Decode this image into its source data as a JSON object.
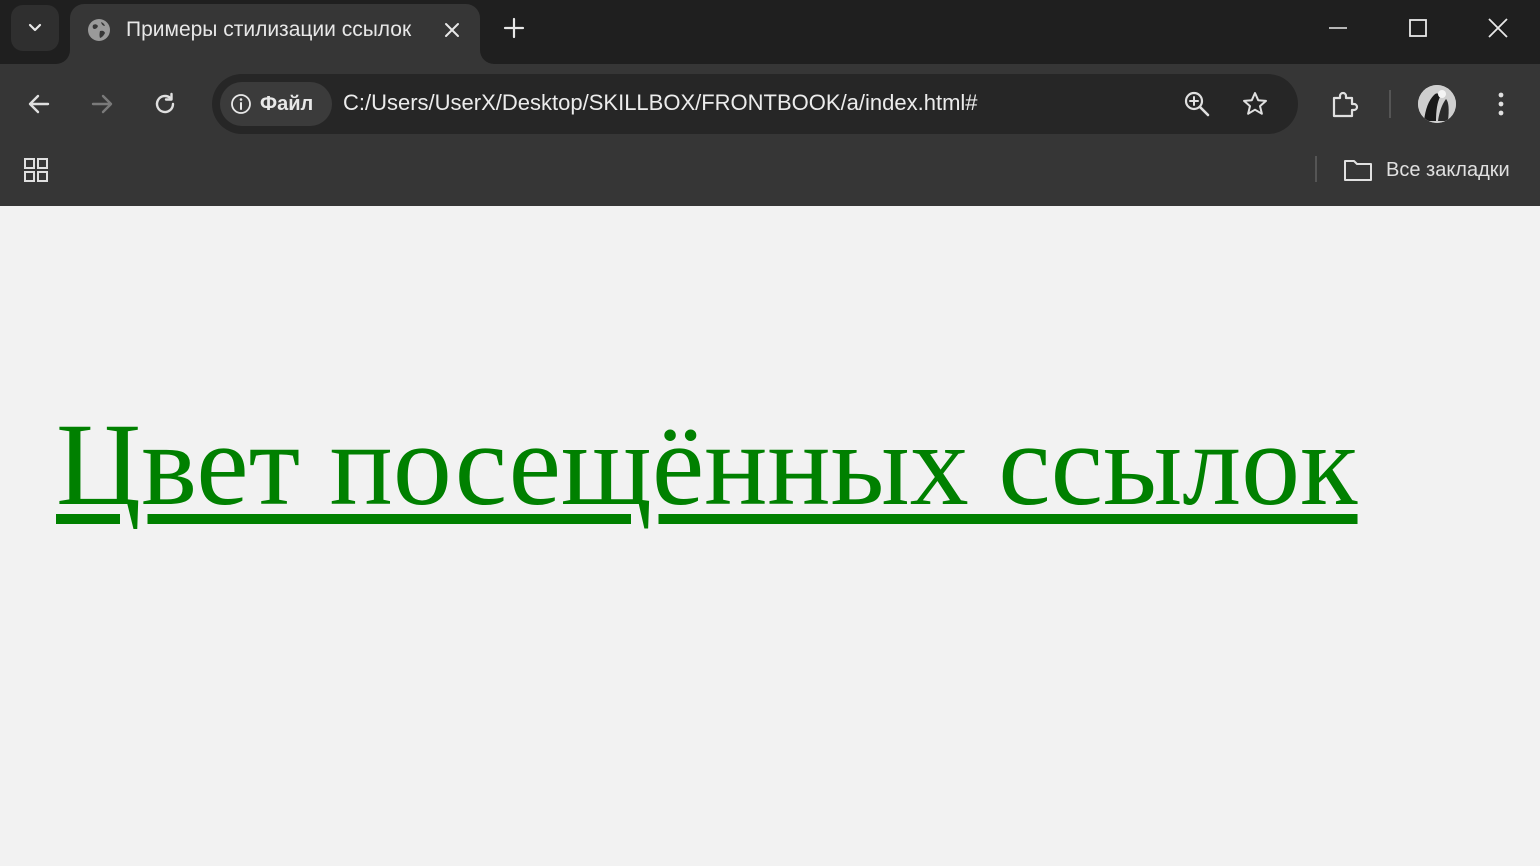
{
  "browser": {
    "tab": {
      "title": "Примеры стилизации ссылок",
      "favicon": "globe-icon"
    },
    "address_bar": {
      "chip_label": "Файл",
      "url": "C:/Users/UserX/Desktop/SKILLBOX/FRONTBOOK/a/index.html#"
    },
    "bookmarks_bar": {
      "all_bookmarks_label": "Все закладки"
    },
    "colors": {
      "tabstrip": "#1f1f1f",
      "toolbar": "#363636",
      "omnibox": "#262626"
    }
  },
  "page": {
    "link_text": "Цвет посещённых ссылок",
    "link_color": "#008000",
    "background": "#f2f2f2"
  }
}
